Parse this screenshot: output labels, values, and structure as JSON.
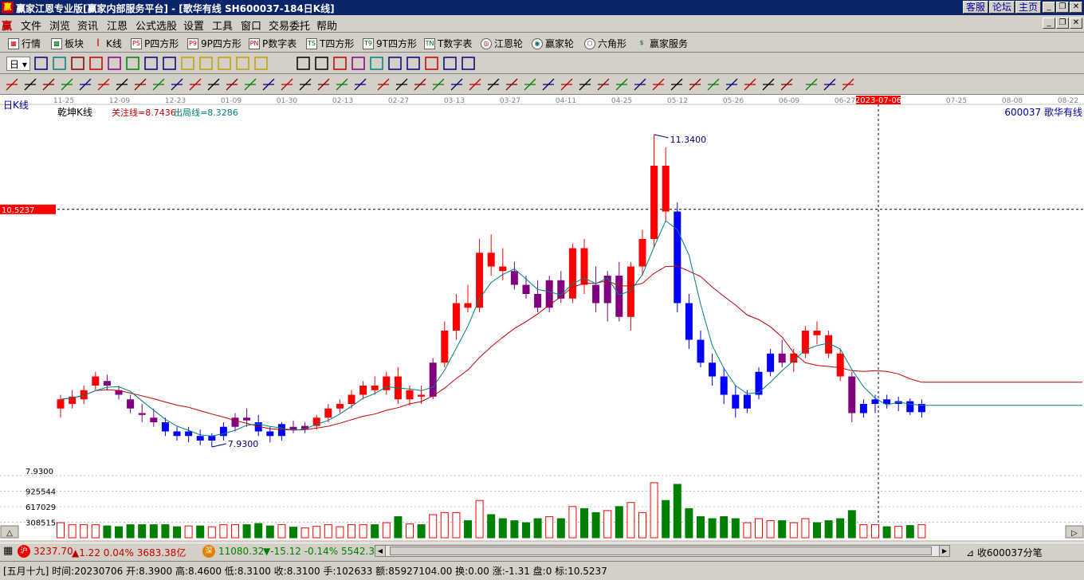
{
  "window": {
    "title": "赢家江恩专业版[赢家内部服务平台] - [歌华有线   SH600037-184日K线]",
    "app_icon": "赢",
    "title_buttons": [
      "客服",
      "论坛",
      "主页"
    ]
  },
  "menu": [
    "文件",
    "浏览",
    "资讯",
    "江恩",
    "公式选股",
    "设置",
    "工具",
    "窗口",
    "交易委托",
    "帮助"
  ],
  "toolbar1": [
    {
      "label": "行情",
      "icon": "grid-icon"
    },
    {
      "label": "板块",
      "icon": "blocks-icon"
    },
    {
      "label": "K线",
      "icon": "candle-icon"
    },
    {
      "label": "P四方形",
      "icon": "PS"
    },
    {
      "label": "9P四方形",
      "icon": "P9"
    },
    {
      "label": "P数字表",
      "icon": "PN"
    },
    {
      "label": "T四方形",
      "icon": "TS"
    },
    {
      "label": "9T四方形",
      "icon": "T9"
    },
    {
      "label": "T数字表",
      "icon": "TN"
    },
    {
      "label": "江恩轮",
      "icon": "wheel-icon"
    },
    {
      "label": "赢家轮",
      "icon": "wheel2-icon"
    },
    {
      "label": "六角形",
      "icon": "hexagon-icon"
    },
    {
      "label": "赢家服务",
      "icon": "service-icon"
    }
  ],
  "period_selector": "日",
  "chart": {
    "period_label": "日K线",
    "indicator_name": "乾坤K线",
    "focus_line_label": "关注线=8.7436",
    "exit_line_label": "出局线=8.3286",
    "stock_label": "600037  歌华有线",
    "crosshair_price": "10.5237",
    "crosshair_date": "2023-07-06",
    "high_label": "11.3400",
    "low_label": "7.9300",
    "axis_price_low": "7.9300",
    "vol_ticks": [
      "925544",
      "617029",
      "308515"
    ],
    "date_ticks": [
      "11-25",
      "12-09",
      "12-23",
      "01-09",
      "01-30",
      "02-13",
      "02-27",
      "03-13",
      "03-27",
      "04-11",
      "04-25",
      "05-12",
      "05-26",
      "06-09",
      "06-27",
      "07-25",
      "08-08",
      "08-22"
    ],
    "colors": {
      "up": "#ff0000",
      "down": "#0000ff",
      "neutral": "#800080",
      "volume": "#008000",
      "ma_short": "#008080",
      "ma_long": "#c00000",
      "crosshair_bg": "#ff0000"
    }
  },
  "chart_data": {
    "type": "candlestick",
    "description_series": [
      {
        "name": "关注线",
        "value": 8.7436
      },
      {
        "name": "出局线",
        "value": 8.3286
      }
    ],
    "ylim": [
      7.93,
      11.34
    ],
    "ohlc": [
      [
        8.35,
        8.5,
        8.25,
        8.45
      ],
      [
        8.4,
        8.55,
        8.35,
        8.48
      ],
      [
        8.45,
        8.6,
        8.4,
        8.55
      ],
      [
        8.6,
        8.75,
        8.55,
        8.7
      ],
      [
        8.65,
        8.72,
        8.55,
        8.6
      ],
      [
        8.55,
        8.6,
        8.45,
        8.5
      ],
      [
        8.45,
        8.5,
        8.3,
        8.35
      ],
      [
        8.3,
        8.4,
        8.2,
        8.28
      ],
      [
        8.25,
        8.35,
        8.15,
        8.2
      ],
      [
        8.2,
        8.25,
        8.05,
        8.1
      ],
      [
        8.1,
        8.15,
        8.0,
        8.05
      ],
      [
        8.05,
        8.15,
        7.98,
        8.1
      ],
      [
        8.05,
        8.12,
        7.95,
        8.0
      ],
      [
        8.0,
        8.08,
        7.93,
        8.05
      ],
      [
        8.05,
        8.2,
        8.0,
        8.15
      ],
      [
        8.15,
        8.3,
        8.1,
        8.25
      ],
      [
        8.25,
        8.35,
        8.15,
        8.22
      ],
      [
        8.2,
        8.28,
        8.05,
        8.1
      ],
      [
        8.1,
        8.15,
        7.98,
        8.05
      ],
      [
        8.05,
        8.2,
        8.0,
        8.18
      ],
      [
        8.15,
        8.22,
        8.08,
        8.12
      ],
      [
        8.12,
        8.2,
        8.08,
        8.16
      ],
      [
        8.16,
        8.28,
        8.12,
        8.25
      ],
      [
        8.25,
        8.4,
        8.2,
        8.35
      ],
      [
        8.35,
        8.45,
        8.3,
        8.4
      ],
      [
        8.4,
        8.55,
        8.35,
        8.5
      ],
      [
        8.5,
        8.65,
        8.45,
        8.6
      ],
      [
        8.6,
        8.7,
        8.5,
        8.55
      ],
      [
        8.55,
        8.75,
        8.5,
        8.7
      ],
      [
        8.7,
        8.8,
        8.4,
        8.45
      ],
      [
        8.45,
        8.6,
        8.38,
        8.55
      ],
      [
        8.5,
        8.6,
        8.4,
        8.48
      ],
      [
        8.48,
        8.9,
        8.45,
        8.85
      ],
      [
        8.85,
        9.3,
        8.8,
        9.2
      ],
      [
        9.2,
        9.6,
        9.1,
        9.5
      ],
      [
        9.5,
        9.7,
        9.4,
        9.45
      ],
      [
        9.45,
        10.2,
        9.4,
        10.05
      ],
      [
        10.05,
        10.25,
        9.8,
        9.9
      ],
      [
        9.9,
        10.1,
        9.75,
        9.85
      ],
      [
        9.85,
        9.95,
        9.65,
        9.7
      ],
      [
        9.7,
        9.8,
        9.55,
        9.6
      ],
      [
        9.6,
        9.75,
        9.4,
        9.45
      ],
      [
        9.45,
        9.8,
        9.4,
        9.75
      ],
      [
        9.75,
        9.85,
        9.5,
        9.55
      ],
      [
        9.55,
        10.15,
        9.5,
        10.1
      ],
      [
        10.1,
        10.2,
        9.6,
        9.7
      ],
      [
        9.7,
        9.9,
        9.4,
        9.5
      ],
      [
        9.5,
        9.85,
        9.3,
        9.8
      ],
      [
        9.8,
        9.95,
        9.3,
        9.35
      ],
      [
        9.35,
        9.95,
        9.2,
        9.9
      ],
      [
        9.9,
        10.3,
        9.8,
        10.2
      ],
      [
        10.2,
        11.34,
        10.1,
        11.0
      ],
      [
        11.0,
        11.2,
        10.4,
        10.5
      ],
      [
        10.5,
        10.6,
        9.4,
        9.5
      ],
      [
        9.5,
        9.6,
        9.0,
        9.1
      ],
      [
        9.1,
        9.2,
        8.8,
        8.85
      ],
      [
        8.85,
        8.95,
        8.6,
        8.7
      ],
      [
        8.7,
        8.8,
        8.4,
        8.5
      ],
      [
        8.5,
        8.6,
        8.25,
        8.35
      ],
      [
        8.35,
        8.55,
        8.3,
        8.5
      ],
      [
        8.5,
        8.8,
        8.45,
        8.75
      ],
      [
        8.75,
        9.0,
        8.7,
        8.95
      ],
      [
        8.95,
        9.1,
        8.8,
        8.85
      ],
      [
        8.85,
        9.0,
        8.75,
        8.95
      ],
      [
        8.95,
        9.25,
        8.9,
        9.2
      ],
      [
        9.2,
        9.3,
        9.05,
        9.15
      ],
      [
        9.15,
        9.2,
        8.9,
        8.95
      ],
      [
        8.95,
        9.0,
        8.65,
        8.7
      ],
      [
        8.7,
        8.75,
        8.2,
        8.3
      ],
      [
        8.3,
        8.45,
        8.25,
        8.4
      ],
      [
        8.4,
        8.5,
        8.3,
        8.45
      ],
      [
        8.45,
        8.5,
        8.35,
        8.4
      ],
      [
        8.4,
        8.48,
        8.32,
        8.43
      ],
      [
        8.43,
        8.46,
        8.28,
        8.31
      ],
      [
        8.31,
        8.45,
        8.25,
        8.4
      ]
    ],
    "volume_max": 1234059
  },
  "status1": {
    "sh_index": "3237.70",
    "sh_change": "▲1.22 0.04% 3683.38亿",
    "sz_index": "11080.32",
    "sz_change": "▼-15.12 -0.14% 5542.3",
    "right_label": "收600037分笔"
  },
  "status2": {
    "text": "[五月十九] 时间:20230706 开:8.3900 高:8.4600 低:8.3100 收:8.3100 手:102633 额:85927104.00 换:0.00 涨:-1.31 盘:0 标:10.5237"
  }
}
